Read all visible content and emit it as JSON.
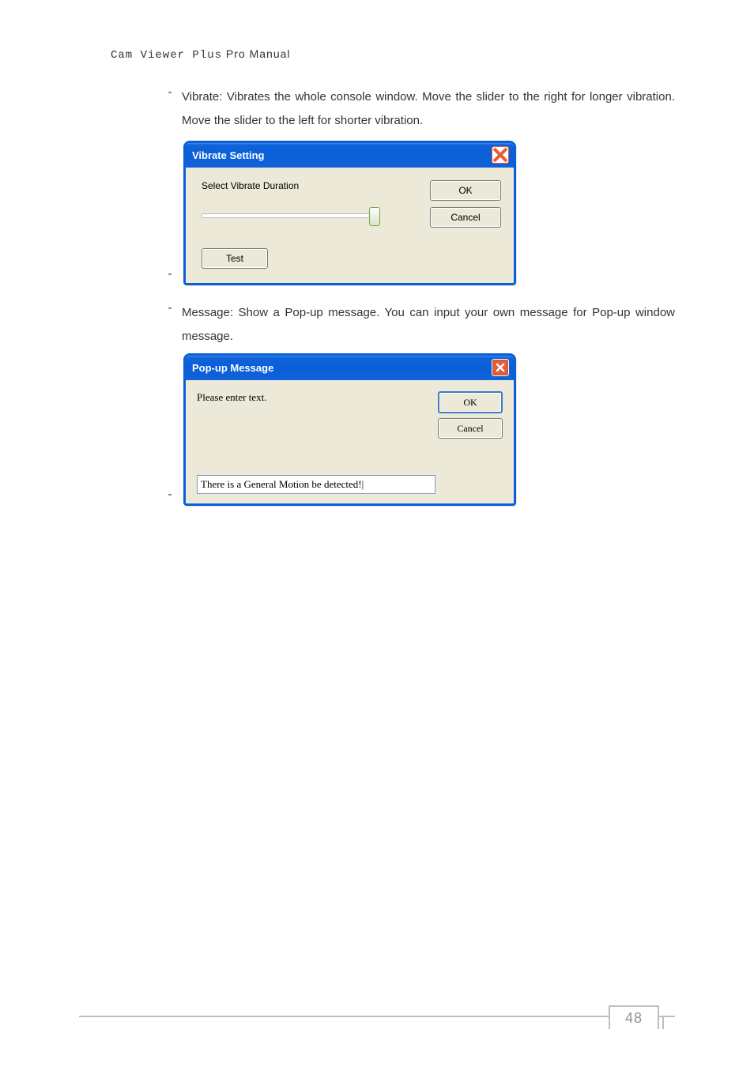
{
  "header": {
    "prefix": "Cam Viewer Plus",
    "suffix": " Pro Manual"
  },
  "item1": {
    "desc": "Vibrate: Vibrates the whole console window. Move the slider to the right for longer vibration. Move the slider to the left for shorter vibration."
  },
  "dlg1": {
    "title": "Vibrate Setting",
    "label": "Select Vibrate Duration",
    "ok": "OK",
    "cancel": "Cancel",
    "test": "Test"
  },
  "item2": {
    "desc": "Message: Show a Pop-up message. You can input your own message for Pop-up window message."
  },
  "dlg2": {
    "title": "Pop-up Message",
    "label": "Please enter text.",
    "ok": "OK",
    "cancel": "Cancel",
    "input_value": "There is a General Motion be detected!|"
  },
  "page_number": "48"
}
